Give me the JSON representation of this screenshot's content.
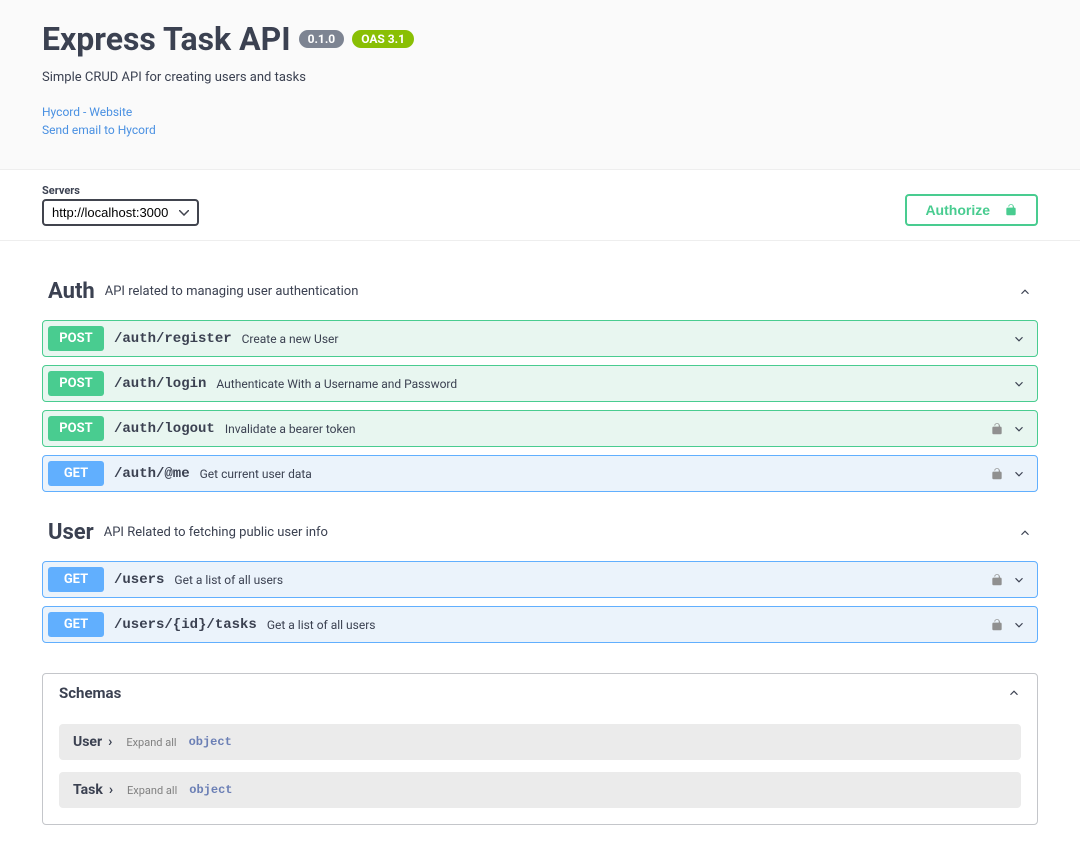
{
  "header": {
    "title": "Express Task API",
    "version": "0.1.0",
    "oas": "OAS 3.1",
    "description": "Simple CRUD API for creating users and tasks",
    "links": [
      {
        "label": "Hycord - Website"
      },
      {
        "label": "Send email to Hycord"
      }
    ]
  },
  "servers": {
    "label": "Servers",
    "selected": "http://localhost:3000"
  },
  "authorize": {
    "label": "Authorize"
  },
  "tags": [
    {
      "name": "Auth",
      "description": "API related to managing user authentication",
      "operations": [
        {
          "method": "POST",
          "path": "/auth/register",
          "summary": "Create a new User",
          "locked": false
        },
        {
          "method": "POST",
          "path": "/auth/login",
          "summary": "Authenticate With a Username and Password",
          "locked": false
        },
        {
          "method": "POST",
          "path": "/auth/logout",
          "summary": "Invalidate a bearer token",
          "locked": true
        },
        {
          "method": "GET",
          "path": "/auth/@me",
          "summary": "Get current user data",
          "locked": true
        }
      ]
    },
    {
      "name": "User",
      "description": "API Related to fetching public user info",
      "operations": [
        {
          "method": "GET",
          "path": "/users",
          "summary": "Get a list of all users",
          "locked": true
        },
        {
          "method": "GET",
          "path": "/users/{id}/tasks",
          "summary": "Get a list of all users",
          "locked": true
        }
      ]
    }
  ],
  "schemas": {
    "title": "Schemas",
    "expand_label": "Expand all",
    "type_label": "object",
    "items": [
      {
        "name": "User"
      },
      {
        "name": "Task"
      }
    ]
  }
}
